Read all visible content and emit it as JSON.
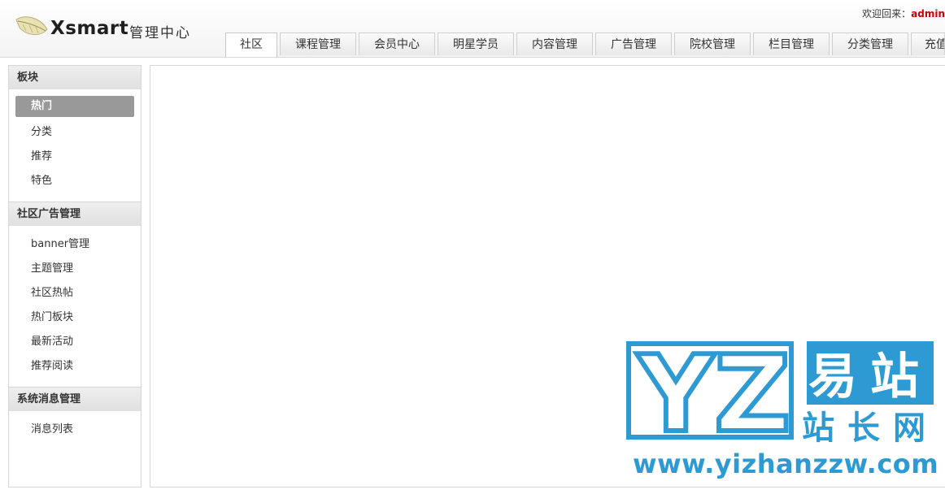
{
  "header": {
    "brand": "Xsmart",
    "subtitle": "管理中心",
    "welcome_label": "欢迎回来：",
    "username": "admin"
  },
  "tabs": [
    {
      "label": "社区",
      "active": true
    },
    {
      "label": "课程管理"
    },
    {
      "label": "会员中心"
    },
    {
      "label": "明星学员"
    },
    {
      "label": "内容管理"
    },
    {
      "label": "广告管理"
    },
    {
      "label": "院校管理"
    },
    {
      "label": "栏目管理"
    },
    {
      "label": "分类管理"
    },
    {
      "label": "充值"
    }
  ],
  "sidebar": {
    "sections": [
      {
        "title": "板块",
        "items": [
          {
            "label": "热门",
            "active": true
          },
          {
            "label": "分类"
          },
          {
            "label": "推荐"
          },
          {
            "label": "特色"
          }
        ]
      },
      {
        "title": "社区广告管理",
        "items": [
          {
            "label": "banner管理"
          },
          {
            "label": "主题管理"
          },
          {
            "label": "社区热帖"
          },
          {
            "label": "热门板块"
          },
          {
            "label": "最新活动"
          },
          {
            "label": "推荐阅读"
          }
        ]
      },
      {
        "title": "系统消息管理",
        "items": [
          {
            "label": "消息列表"
          }
        ]
      }
    ]
  },
  "watermark": {
    "glyphs": "YZ",
    "line1": "易站",
    "line2": "站长网",
    "url": "www.yizhanzzw.com",
    "color": "#2d9ad4"
  }
}
